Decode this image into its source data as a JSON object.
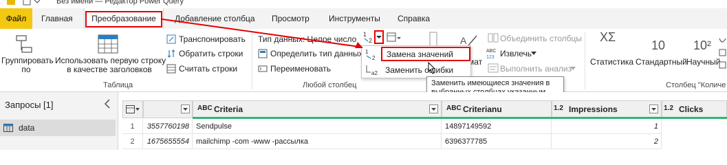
{
  "window": {
    "title": "Без имени — Редактор Power Query"
  },
  "tabs": [
    {
      "label": "Файл"
    },
    {
      "label": "Главная"
    },
    {
      "label": "Преобразование"
    },
    {
      "label": "Добавление столбца"
    },
    {
      "label": "Просмотр"
    },
    {
      "label": "Инструменты"
    },
    {
      "label": "Справка"
    }
  ],
  "ribbon": {
    "table_group": {
      "label": "Таблица",
      "group_by": "Группировать\nпо",
      "use_first_row": "Использовать первую строку\nв качестве заголовков",
      "transpose": "Транспонировать",
      "reverse_rows": "Обратить строки",
      "count_rows": "Считать строки"
    },
    "any_column_group": {
      "label": "Любой столбец",
      "data_type": "Тип данных: Целое число",
      "detect_type": "Определить тип данных",
      "rename": "Переименовать",
      "format_partial": "мат"
    },
    "replace_menu": {
      "replace_values": "Замена значений",
      "replace_errors": "Заменить ошибки"
    },
    "text_column_group": {
      "merge_columns": "Объединить столбцы",
      "extract": "Извлечь",
      "parse": "Выполнить анализ"
    },
    "number_column_group": {
      "label": "Столбец \"Количе",
      "statistics": "Статистика",
      "standard": "Стандартный",
      "scientific": "Научный",
      "standard_icon_text": "10",
      "scientific_icon_text": "10²",
      "stats_icon_text": "XΣ"
    }
  },
  "tooltip": {
    "text": "Заменить имеющиеся значения в выбранных столбцах указанным новым значением."
  },
  "sidebar": {
    "title": "Запросы [1]",
    "items": [
      {
        "label": "data"
      }
    ]
  },
  "table": {
    "columns": [
      {
        "type_icon": "ABC",
        "name": "Criteria"
      },
      {
        "type_icon": "ABC",
        "name": "Criterianu"
      },
      {
        "type_icon": "1.2",
        "name": "Impressions"
      },
      {
        "type_icon": "1.2",
        "name": "Clicks"
      }
    ],
    "rows": [
      {
        "index": "1",
        "id": "3557760198",
        "criteria": "Sendpulse",
        "criteria_id": "14897149592",
        "impressions": "1"
      },
      {
        "index": "2",
        "id": "1675655554",
        "criteria": "mailchimp -com -www -рассылка",
        "criteria_id": "6396377785",
        "impressions": "2"
      }
    ]
  },
  "colors": {
    "file_tab": "#f2c811",
    "highlight_red": "#e30000",
    "accent_blue": "#2b7ec3",
    "header_bg": "#f0f0f0"
  }
}
